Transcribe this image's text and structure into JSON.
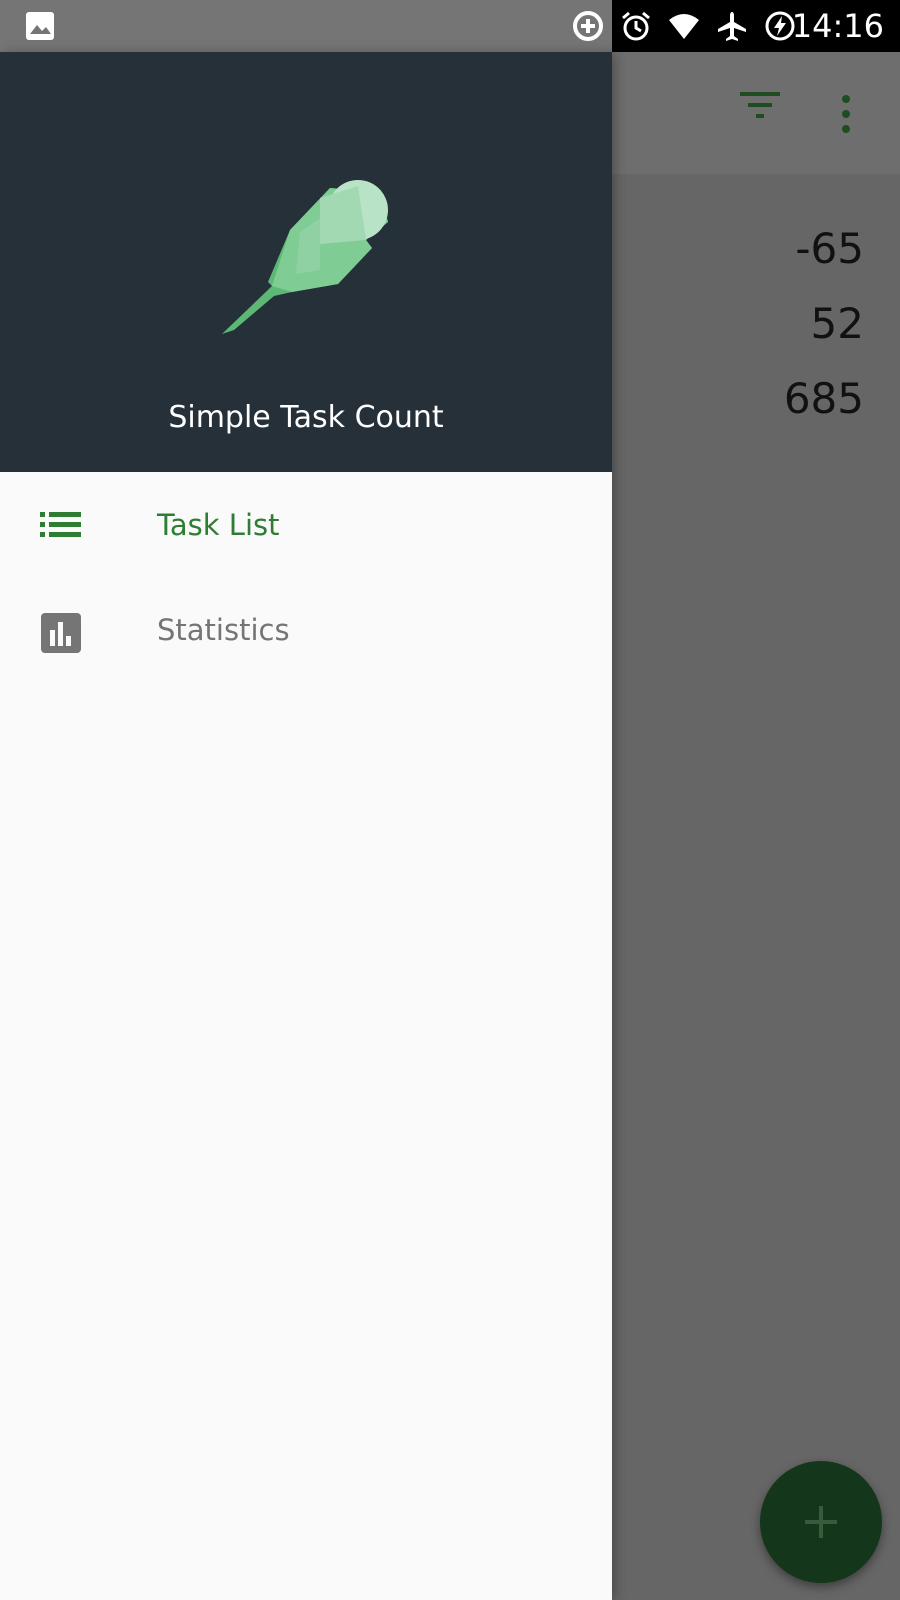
{
  "status_bar": {
    "time": "14:16",
    "icons": [
      "image-icon",
      "data-saver-icon",
      "alarm-icon",
      "wifi-icon",
      "airplane-icon",
      "battery-saver-icon"
    ]
  },
  "drawer": {
    "app_name": "Simple Task Count",
    "logo": "feather-icon",
    "items": [
      {
        "label": "Task List",
        "icon": "list-icon",
        "active": true
      },
      {
        "label": "Statistics",
        "icon": "bar-chart-icon",
        "active": false
      }
    ]
  },
  "main": {
    "toolbar_icons": [
      "filter-icon",
      "more-vert-icon"
    ],
    "counts": [
      "-65",
      "52",
      "685"
    ],
    "fab_icon": "add-icon"
  },
  "colors": {
    "accent": "#2e7d32",
    "drawer_header": "#263038",
    "fab": "#14361a"
  }
}
